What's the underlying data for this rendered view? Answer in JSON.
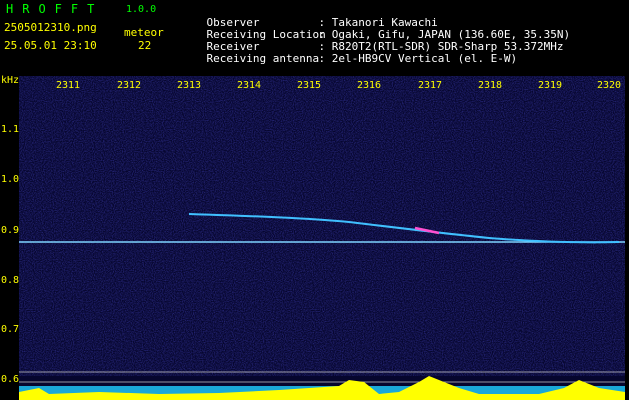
{
  "header": {
    "app_title": "HROFFT",
    "version": "1.0.0",
    "filename": "2505012310.png",
    "mode": "meteor",
    "datetime": "25.05.01 23:10",
    "count": "22"
  },
  "station": [
    {
      "label": "Observer",
      "value": ": Takanori Kawachi"
    },
    {
      "label": "Receiving Location",
      "value": ": Ogaki, Gifu, JAPAN (136.60E, 35.35N)"
    },
    {
      "label": "Receiver",
      "value": ": R820T2(RTL-SDR) SDR-Sharp 53.372MHz"
    },
    {
      "label": "Receiving antenna",
      "value": ": 2el-HB9CV Vertical (el. E-W)"
    }
  ],
  "axis": {
    "unit": "kHz",
    "y_ticks": [
      "1.1",
      "1.0",
      "0.9",
      "0.8",
      "0.7",
      "0.6"
    ],
    "x_ticks": [
      "2311",
      "2312",
      "2313",
      "2314",
      "2315",
      "2316",
      "2317",
      "2318",
      "2319",
      "2320"
    ]
  },
  "colors": {
    "label": "#ffff00",
    "title": "#00ff00",
    "info": "#ffffff",
    "background": "#06062e",
    "trace": "#40c0ff"
  }
}
